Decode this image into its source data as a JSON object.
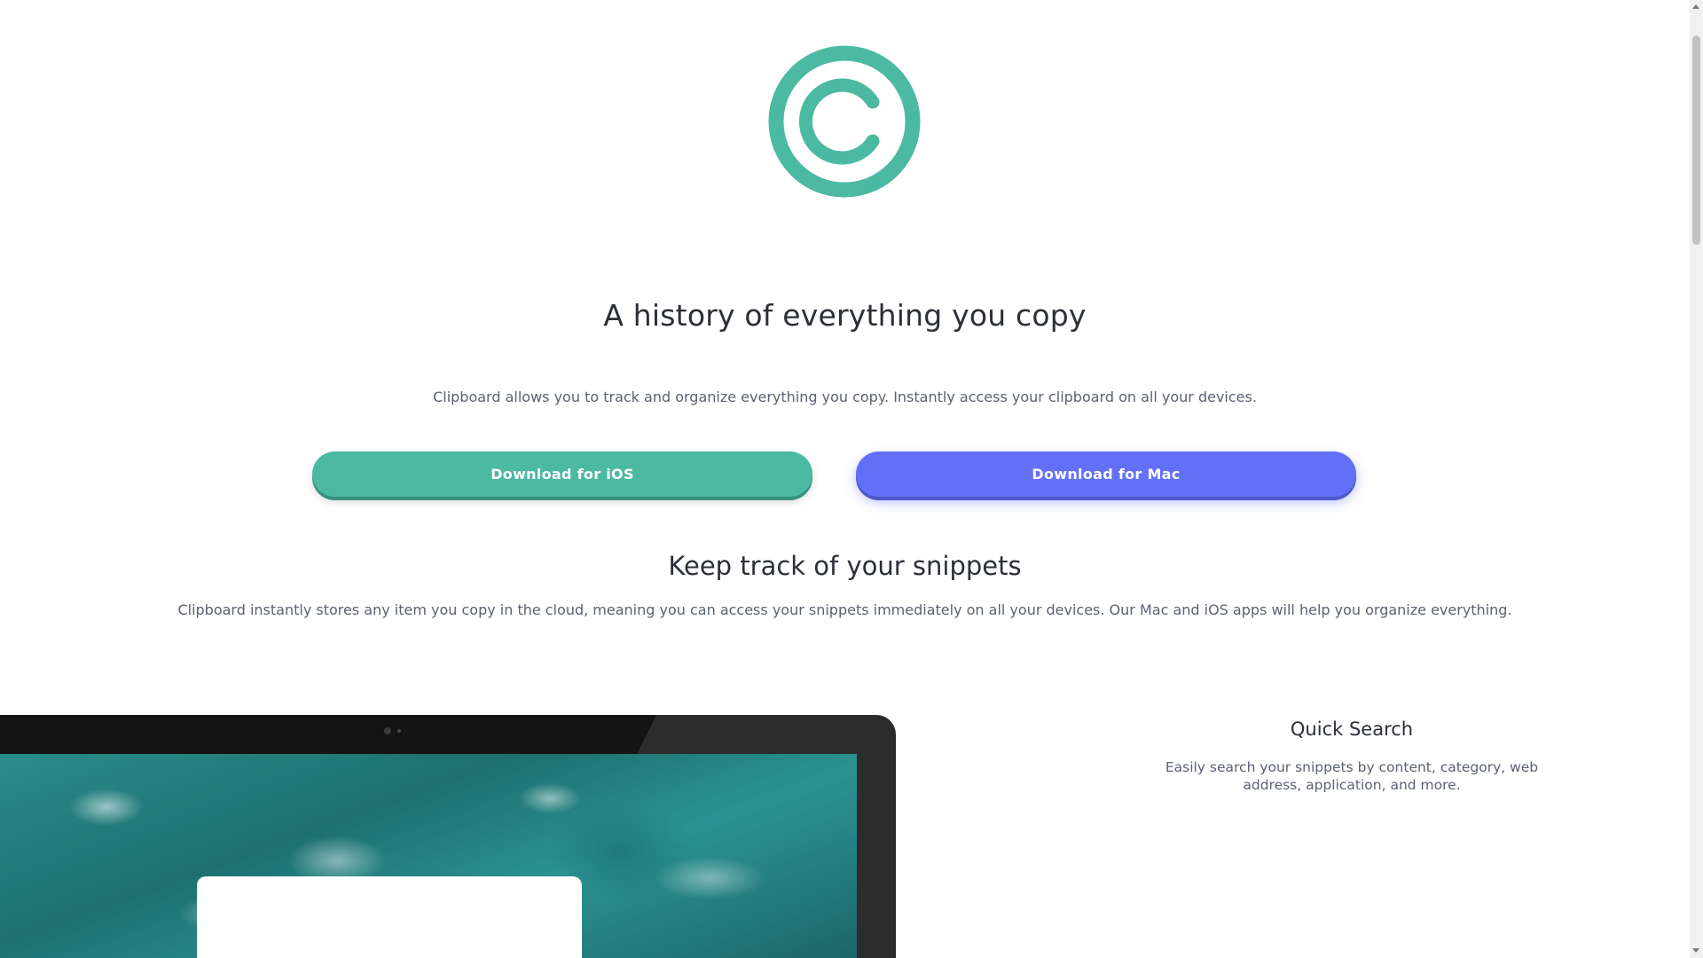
{
  "hero": {
    "logo_icon": "clipboard-c-logo-icon",
    "logo_color": "#4cb9a2",
    "headline": "A history of everything you copy",
    "lead": "Clipboard allows you to track and organize everything you copy. Instantly access your clipboard on all your devices."
  },
  "buttons": {
    "ios_label": "Download for iOS",
    "ios_color": "#4cb9a2",
    "mac_label": "Download for Mac",
    "mac_color": "#6270f7"
  },
  "snippets": {
    "title": "Keep track of your snippets",
    "description": "Clipboard instantly stores any item you copy in the cloud, meaning you can access your snippets immediately on all your devices. Our Mac and iOS apps will help you organize everything."
  },
  "feature": {
    "title": "Quick Search",
    "description": "Easily search your snippets by content, category, web address, application, and more."
  }
}
